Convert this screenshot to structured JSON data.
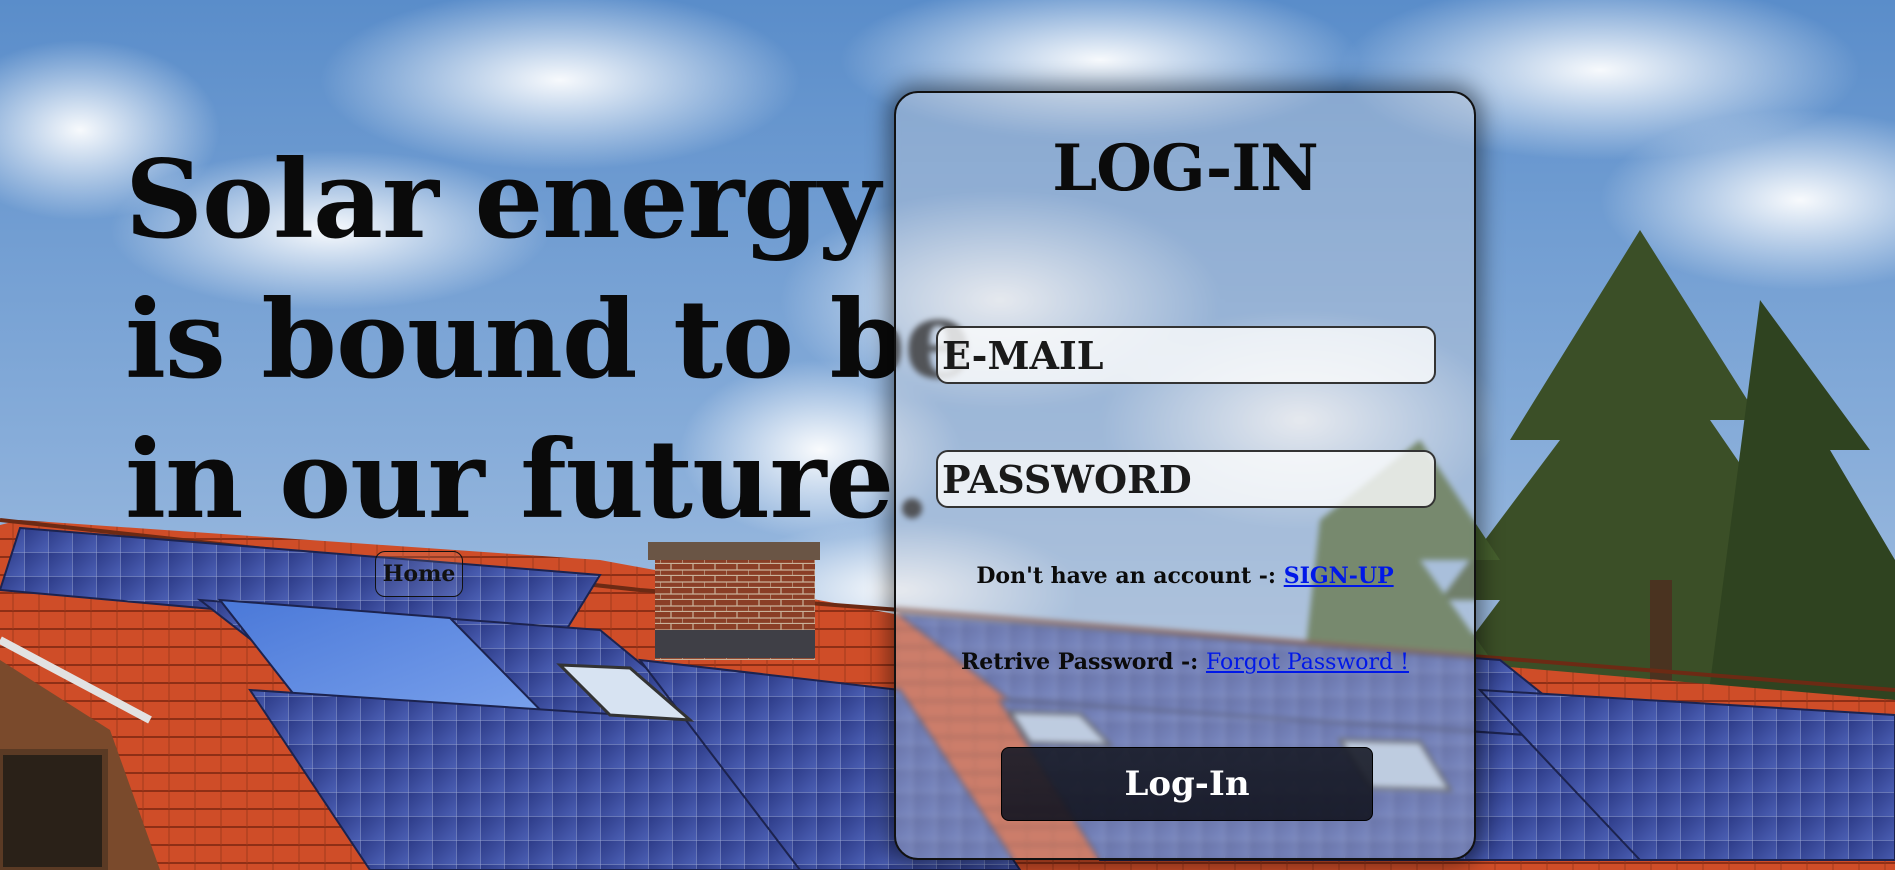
{
  "hero": {
    "headline_lines": [
      "Solar energy",
      "is bound to be",
      "in our future."
    ],
    "home_label": "Home"
  },
  "login": {
    "title": "LOG-IN",
    "email_placeholder": "E-MAIL",
    "password_placeholder": "PASSWORD",
    "signup_prompt": "Don't have an account -: ",
    "signup_link": "SIGN-UP",
    "retrieve_prompt": "Retrive Password -: ",
    "forgot_link": "Forgot Password !",
    "submit_label": "Log-In"
  },
  "colors": {
    "link": "#0018e8",
    "button_bg": "#1a1c28",
    "text": "#0b0b0b"
  }
}
